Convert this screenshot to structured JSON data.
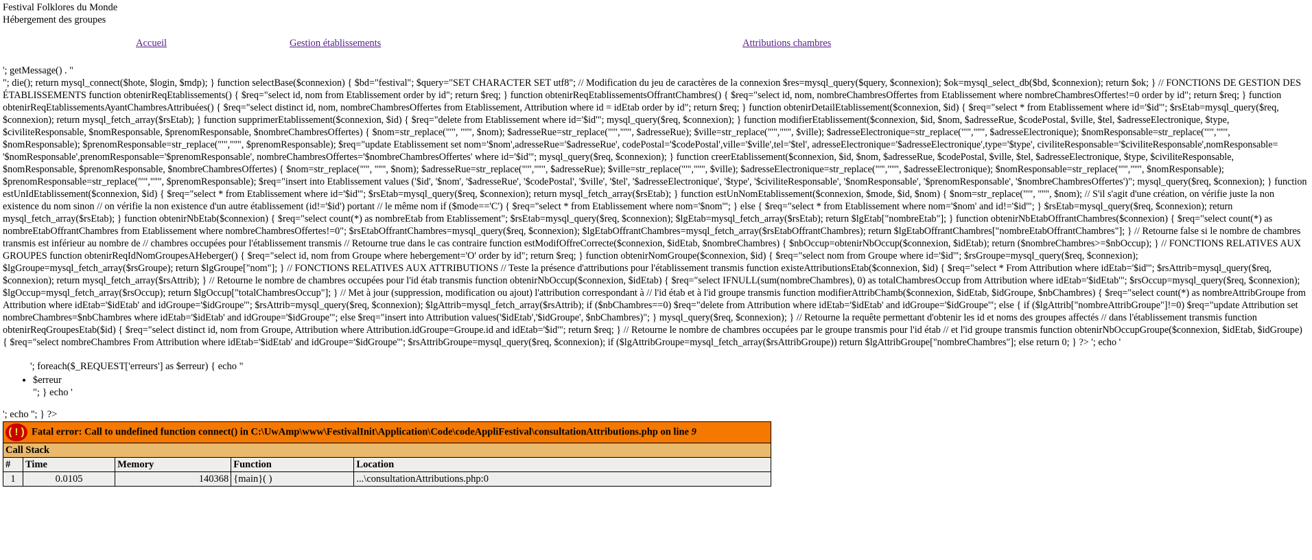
{
  "header": {
    "line1": "Festival Folklores du Monde",
    "line2": "Hébergement des groupes"
  },
  "nav": {
    "home": "Accueil",
    "manage": "Gestion établissements",
    "attributions": "Attributions chambres"
  },
  "source": {
    "line_a": "'; getMessage() . \"",
    "body": "\"; die(); return mysql_connect($hote, $login, $mdp); } function selectBase($connexion) { $bd=\"festival\"; $query=\"SET CHARACTER SET utf8\"; // Modification du jeu de caractères de la connexion $res=mysql_query($query, $connexion); $ok=mysql_select_db($bd, $connexion); return $ok; } // FONCTIONS DE GESTION DES ÉTABLISSEMENTS function obtenirReqEtablissements() { $req=\"select id, nom from Etablissement order by id\"; return $req; } function obtenirReqEtablissementsOffrantChambres() { $req=\"select id, nom, nombreChambresOffertes from Etablissement where nombreChambresOffertes!=0 order by id\"; return $req; } function obtenirReqEtablissementsAyantChambresAttribuées() { $req=\"select distinct id, nom, nombreChambresOffertes from Etablissement, Attribution where id = idEtab order by id\"; return $req; } function obtenirDetailEtablissement($connexion, $id) { $req=\"select * from Etablissement where id='$id'\"; $rsEtab=mysql_query($req, $connexion); return mysql_fetch_array($rsEtab); } function supprimerEtablissement($connexion, $id) { $req=\"delete from Etablissement where id='$id'\"; mysql_query($req, $connexion); } function modifierEtablissement($connexion, $id, $nom, $adresseRue, $codePostal, $ville, $tel, $adresseElectronique, $type, $civiliteResponsable, $nomResponsable, $prenomResponsable, $nombreChambresOffertes) { $nom=str_replace(\"'\", \"''\", $nom); $adresseRue=str_replace(\"'\",\"''\", $adresseRue); $ville=str_replace(\"'\",\"''\", $ville); $adresseElectronique=str_replace(\"'\",\"''\", $adresseElectronique); $nomResponsable=str_replace(\"'\",\"''\", $nomResponsable); $prenomResponsable=str_replace(\"'\",\"''\", $prenomResponsable); $req=\"update Etablissement set nom='$nom',adresseRue='$adresseRue', codePostal='$codePostal',ville='$ville',tel='$tel', adresseElectronique='$adresseElectronique',type='$type', civiliteResponsable='$civiliteResponsable',nomResponsable= '$nomResponsable',prenomResponsable='$prenomResponsable', nombreChambresOffertes='$nombreChambresOffertes' where id='$id'\"; mysql_query($req, $connexion); } function creerEtablissement($connexion, $id, $nom, $adresseRue, $codePostal, $ville, $tel, $adresseElectronique, $type, $civiliteResponsable, $nomResponsable, $prenomResponsable, $nombreChambresOffertes) { $nom=str_replace(\"'\", \"''\", $nom); $adresseRue=str_replace(\"'\",\"''\", $adresseRue); $ville=str_replace(\"'\",\"''\", $ville); $adresseElectronique=str_replace(\"'\",\"''\", $adresseElectronique); $nomResponsable=str_replace(\"'\",\"''\", $nomResponsable); $prenomResponsable=str_replace(\"'\",\"''\", $prenomResponsable); $req=\"insert into Etablissement values ('$id', '$nom', '$adresseRue', '$codePostal', '$ville', '$tel', '$adresseElectronique', '$type', '$civiliteResponsable', '$nomResponsable', '$prenomResponsable', '$nombreChambresOffertes')\"; mysql_query($req, $connexion); } function estUnIdEtablissement($connexion, $id) { $req=\"select * from Etablissement where id='$id'\"; $rsEtab=mysql_query($req, $connexion); return mysql_fetch_array($rsEtab); } function estUnNomEtablissement($connexion, $mode, $id, $nom) { $nom=str_replace(\"'\", \"''\", $nom); // S'il s'agit d'une création, on vérifie juste la non existence du nom sinon // on vérifie la non existence d'un autre établissement (id!='$id') portant // le même nom if ($mode=='C') { $req=\"select * from Etablissement where nom='$nom'\"; } else { $req=\"select * from Etablissement where nom='$nom' and id!='$id'\"; } $rsEtab=mysql_query($req, $connexion); return mysql_fetch_array($rsEtab); } function obtenirNbEtab($connexion) { $req=\"select count(*) as nombreEtab from Etablissement\"; $rsEtab=mysql_query($req, $connexion); $lgEtab=mysql_fetch_array($rsEtab); return $lgEtab[\"nombreEtab\"]; } function obtenirNbEtabOffrantChambres($connexion) { $req=\"select count(*) as nombreEtabOffrantChambres from Etablissement where nombreChambresOffertes!=0\"; $rsEtabOffrantChambres=mysql_query($req, $connexion); $lgEtabOffrantChambres=mysql_fetch_array($rsEtabOffrantChambres); return $lgEtabOffrantChambres[\"nombreEtabOffrantChambres\"]; } // Retourne false si le nombre de chambres transmis est inférieur au nombre de // chambres occupées pour l'établissement transmis // Retourne true dans le cas contraire function estModifOffreCorrecte($connexion, $idEtab, $nombreChambres) { $nbOccup=obtenirNbOccup($connexion, $idEtab); return ($nombreChambres>=$nbOccup); } // FONCTIONS RELATIVES AUX GROUPES function obtenirReqIdNomGroupesAHeberger() { $req=\"select id, nom from Groupe where hebergement='O' order by id\"; return $req; } function obtenirNomGroupe($connexion, $id) { $req=\"select nom from Groupe where id='$id'\"; $rsGroupe=mysql_query($req, $connexion); $lgGroupe=mysql_fetch_array($rsGroupe); return $lgGroupe[\"nom\"]; } // FONCTIONS RELATIVES AUX ATTRIBUTIONS // Teste la présence d'attributions pour l'établissement transmis function existeAttributionsEtab($connexion, $id) { $req=\"select * From Attribution where idEtab='$id'\"; $rsAttrib=mysql_query($req, $connexion); return mysql_fetch_array($rsAttrib); } // Retourne le nombre de chambres occupées pour l'id étab transmis function obtenirNbOccup($connexion, $idEtab) { $req=\"select IFNULL(sum(nombreChambres), 0) as totalChambresOccup from Attribution where idEtab='$idEtab'\"; $rsOccup=mysql_query($req, $connexion); $lgOccup=mysql_fetch_array($rsOccup); return $lgOccup[\"totalChambresOccup\"]; } // Met à jour (suppression, modification ou ajout) l'attribution correspondant à // l'id étab et à l'id groupe transmis function modifierAttribChamb($connexion, $idEtab, $idGroupe, $nbChambres) { $req=\"select count(*) as nombreAttribGroupe from Attribution where idEtab='$idEtab' and idGroupe='$idGroupe'\"; $rsAttrib=mysql_query($req, $connexion); $lgAttrib=mysql_fetch_array($rsAttrib); if ($nbChambres==0) $req=\"delete from Attribution where idEtab='$idEtab' and idGroupe='$idGroupe'\"; else { if ($lgAttrib[\"nombreAttribGroupe\"]!=0) $req=\"update Attribution set nombreChambres=$nbChambres where idEtab='$idEtab' and idGroupe='$idGroupe'\"; else $req=\"insert into Attribution values('$idEtab','$idGroupe', $nbChambres)\"; } mysql_query($req, $connexion); } // Retourne la requête permettant d'obtenir les id et noms des groupes affectés // dans l'établissement transmis function obtenirReqGroupesEtab($id) { $req=\"select distinct id, nom from Groupe, Attribution where Attribution.idGroupe=Groupe.id and idEtab='$id'\"; return $req; } // Retourne le nombre de chambres occupées par le groupe transmis pour l'id étab // et l'id groupe transmis function obtenirNbOccupGroupe($connexion, $idEtab, $idGroupe) { $req=\"select nombreChambres From Attribution where idEtab='$idEtab' and idGroupe='$idGroupe'\"; $rsAttribGroupe=mysql_query($req, $connexion); if ($lgAttribGroupe=mysql_fetch_array($rsAttribGroupe)) return $lgAttribGroupe[\"nombreChambres\"]; else return 0; } ?> '; echo '",
    "foreach": "'; foreach($_REQUEST['erreurs'] as $erreur) { echo \"",
    "list_item_1": "$erreur",
    "list_item_2": "\"; } echo '",
    "trailer": "'; echo ''; } ?>"
  },
  "xdebug": {
    "icon": "( ! )",
    "error_message": "Fatal error: Call to undefined function connect() in C:\\UwAmp\\www\\FestivalInit\\Application\\Code\\codeAppliFestival\\consultationAttributions.php on line ",
    "error_line": "9",
    "call_stack": "Call Stack",
    "headers": [
      "#",
      "Time",
      "Memory",
      "Function",
      "Location"
    ],
    "row": {
      "num": "1",
      "time": "0.0105",
      "memory": "140368",
      "function": "{main}( )",
      "location": "...\\consultationAttributions.php:0"
    }
  }
}
